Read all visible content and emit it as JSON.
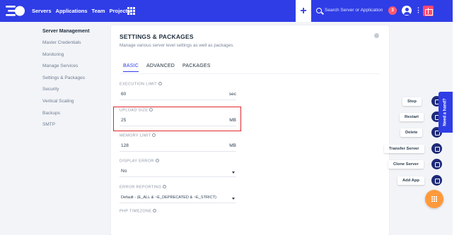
{
  "topbar": {
    "nav": [
      "Servers",
      "Applications",
      "Team",
      "Projects"
    ],
    "add_label": "+",
    "search_placeholder": "Search Server or Application",
    "notification_count": "3",
    "more_label": "⋮"
  },
  "sidebar": {
    "title": "Server Management",
    "items": [
      {
        "label": "Master Credentials"
      },
      {
        "label": "Monitoring"
      },
      {
        "label": "Manage Services"
      },
      {
        "label": "Settings & Packages"
      },
      {
        "label": "Security"
      },
      {
        "label": "Vertical Scaling"
      },
      {
        "label": "Backups"
      },
      {
        "label": "SMTP"
      }
    ]
  },
  "card": {
    "title": "SETTINGS & PACKAGES",
    "subtitle": "Manage various server level settings as well as packages.",
    "tabs": [
      {
        "label": "BASIC",
        "active": true
      },
      {
        "label": "ADVANCED",
        "active": false
      },
      {
        "label": "PACKAGES",
        "active": false
      }
    ],
    "fields": {
      "execution_limit": {
        "label": "EXECUTION LIMIT",
        "value": "60",
        "unit": "sec"
      },
      "upload_size": {
        "label": "UPLOAD SIZE",
        "value": "25",
        "unit": "MB"
      },
      "memory_limit": {
        "label": "MEMORY LIMIT",
        "value": "128",
        "unit": "MB"
      },
      "display_error": {
        "label": "DISPLAY ERROR",
        "value": "No"
      },
      "error_reporting": {
        "label": "ERROR REPORTING",
        "value": "Default - (E_ALL & ~E_DEPRECATED & ~E_STRICT)"
      },
      "php_timezone": {
        "label": "PHP TIMEZONE"
      }
    }
  },
  "actions": {
    "stop": "Stop",
    "restart": "Restart",
    "delete": "Delete",
    "transfer": "Transfer Server",
    "clone": "Clone Server",
    "add_app": "Add App",
    "need_hand": "Need a hand?"
  },
  "colors": {
    "brand": "#2f3de6",
    "fab": "#ff9a3c",
    "highlight": "#e0262d",
    "gift": "#ff4770"
  },
  "icons": [
    "menu-logo-icon",
    "apps-grid-icon",
    "search-icon",
    "bell-icon",
    "user-icon",
    "gift-icon",
    "info-icon",
    "floating-menu-icon"
  ]
}
